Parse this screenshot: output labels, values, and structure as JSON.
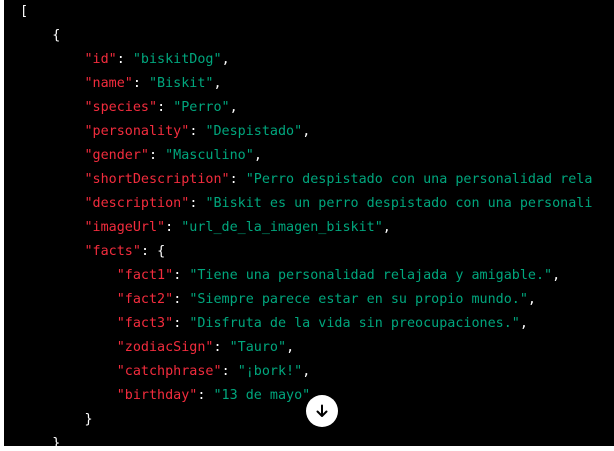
{
  "colors": {
    "background": "#000000",
    "key": "#f22c3d",
    "string": "#00a67d",
    "punctuation": "#ffffff"
  },
  "code": {
    "open_bracket": "[",
    "open_brace": "{",
    "lines": [
      {
        "key": "\"id\"",
        "value": "\"biskitDog\"",
        "tail": ","
      },
      {
        "key": "\"name\"",
        "value": "\"Biskit\"",
        "tail": ","
      },
      {
        "key": "\"species\"",
        "value": "\"Perro\"",
        "tail": ","
      },
      {
        "key": "\"personality\"",
        "value": "\"Despistado\"",
        "tail": ","
      },
      {
        "key": "\"gender\"",
        "value": "\"Masculino\"",
        "tail": ","
      },
      {
        "key": "\"shortDescription\"",
        "value": "\"Perro despistado con una personalidad rela",
        "tail": ""
      },
      {
        "key": "\"description\"",
        "value": "\"Biskit es un perro despistado con una personali",
        "tail": ""
      },
      {
        "key": "\"imageUrl\"",
        "value": "\"url_de_la_imagen_biskit\"",
        "tail": ","
      },
      {
        "key": "\"facts\"",
        "value": "",
        "tail": "{"
      }
    ],
    "facts": [
      {
        "key": "\"fact1\"",
        "value": "\"Tiene una personalidad relajada y amigable.\"",
        "tail": ","
      },
      {
        "key": "\"fact2\"",
        "value": "\"Siempre parece estar en su propio mundo.\"",
        "tail": ","
      },
      {
        "key": "\"fact3\"",
        "value": "\"Disfruta de la vida sin preocupaciones.\"",
        "tail": ","
      },
      {
        "key": "\"zodiacSign\"",
        "value": "\"Tauro\"",
        "tail": ","
      },
      {
        "key": "\"catchphrase\"",
        "value": "\"¡bork!\"",
        "tail": ","
      },
      {
        "key": "\"birthday\"",
        "value": "\"13 de mayo\"",
        "tail": ""
      }
    ],
    "close_facts": "}",
    "close_object": "}"
  },
  "scroll_button": {
    "icon": "arrow-down-icon"
  }
}
